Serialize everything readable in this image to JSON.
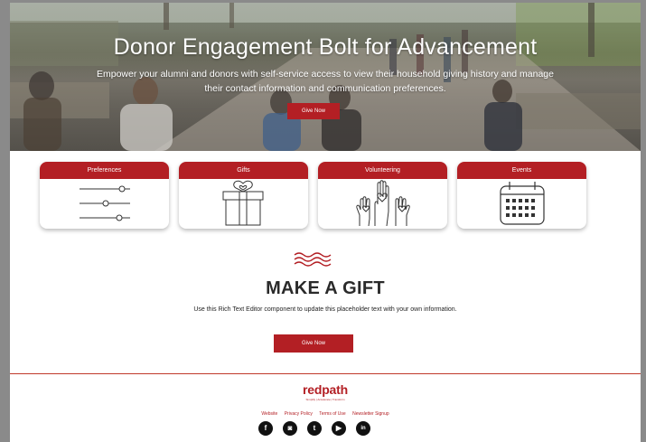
{
  "hero": {
    "title": "Donor Engagement Bolt for Advancement",
    "subtitle": "Empower your alumni and donors with self-service access to view their household giving history and manage their contact information and communication preferences.",
    "button_label": "Give Now"
  },
  "cards": [
    {
      "label": "Preferences",
      "icon": "sliders-icon"
    },
    {
      "label": "Gifts",
      "icon": "gift-icon"
    },
    {
      "label": "Volunteering",
      "icon": "raised-hands-icon"
    },
    {
      "label": "Events",
      "icon": "calendar-icon"
    }
  ],
  "gift_section": {
    "title": "MAKE A GIFT",
    "text": "Use this Rich Text Editor component to update this placeholder text with your own information.",
    "button_label": "Give Now"
  },
  "footer": {
    "logo_text": "redpath",
    "logo_tagline": "Simplify | Accelerate | Transform",
    "links": [
      "Website",
      "Privacy Policy",
      "Terms of Use",
      "Newsletter Signup"
    ],
    "socials": [
      {
        "icon": "facebook-icon",
        "glyph": "f"
      },
      {
        "icon": "instagram-icon",
        "glyph": "◙"
      },
      {
        "icon": "twitter-icon",
        "glyph": "t"
      },
      {
        "icon": "youtube-icon",
        "glyph": "▶"
      },
      {
        "icon": "linkedin-icon",
        "glyph": "in"
      }
    ]
  },
  "colors": {
    "accent": "#b31f24",
    "background": "#8a8a8a"
  }
}
